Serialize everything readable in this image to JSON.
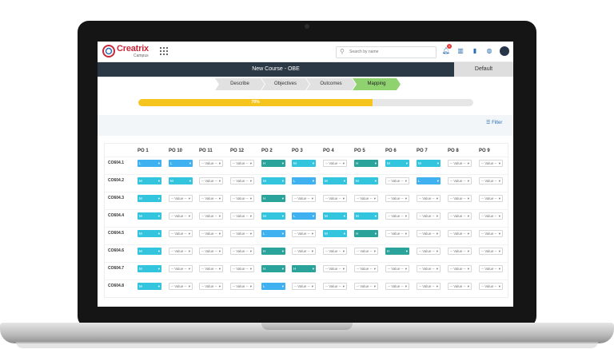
{
  "app": {
    "brand": "Creatrix",
    "brand_sub": "Campus",
    "search_placeholder": "Search by name",
    "notification_count": "1",
    "page_title": "New Course - OBE",
    "default_tab": "Default",
    "filter_label": "Filter"
  },
  "steps": [
    {
      "label": "Describe",
      "active": false
    },
    {
      "label": "Objectives",
      "active": false
    },
    {
      "label": "Outcomes",
      "active": false
    },
    {
      "label": "Mapping",
      "active": true
    }
  ],
  "progress": {
    "percent": 70,
    "label": "70%"
  },
  "colors": {
    "L": "#3fb0f0",
    "M": "#33c4de",
    "H": "#2aa39b",
    "progress": "#f5c51e",
    "accent": "#c8283a"
  },
  "icons": [
    "logo-icon",
    "apps-grid-icon",
    "search-icon",
    "bell-icon",
    "building-icon",
    "book-icon",
    "globe-icon",
    "avatar-icon",
    "filter-icon"
  ],
  "mapping": {
    "columns": [
      "PO 1",
      "PO 10",
      "PO 11",
      "PO 12",
      "PO 2",
      "PO 3",
      "PO 4",
      "PO 5",
      "PO 6",
      "PO 7",
      "PO 8",
      "PO 9"
    ],
    "empty_value": "-- Value --",
    "rows": [
      {
        "label": "CO604.1",
        "values": [
          "L",
          "L",
          "",
          "",
          "H",
          "M",
          "",
          "H",
          "M",
          "M",
          "",
          ""
        ]
      },
      {
        "label": "CO604.2",
        "values": [
          "M",
          "M",
          "",
          "",
          "M",
          "L",
          "M",
          "M",
          "",
          "L",
          "",
          ""
        ]
      },
      {
        "label": "CO604.3",
        "values": [
          "M",
          "",
          "",
          "",
          "H",
          "",
          "",
          "",
          "",
          "",
          "",
          ""
        ]
      },
      {
        "label": "CO604.4",
        "values": [
          "M",
          "",
          "",
          "",
          "M",
          "L",
          "M",
          "M",
          "",
          "",
          "",
          ""
        ]
      },
      {
        "label": "CO604.5",
        "values": [
          "M",
          "",
          "",
          "",
          "L",
          "",
          "M",
          "H",
          "",
          "",
          "",
          ""
        ]
      },
      {
        "label": "CO604.6",
        "values": [
          "M",
          "",
          "",
          "",
          "H",
          "",
          "",
          "",
          "H",
          "",
          "",
          ""
        ]
      },
      {
        "label": "CO604.7",
        "values": [
          "M",
          "",
          "",
          "",
          "H",
          "H",
          "",
          "",
          "",
          "",
          "",
          ""
        ]
      },
      {
        "label": "CO604.8",
        "values": [
          "M",
          "",
          "",
          "",
          "L",
          "",
          "",
          "",
          "",
          "",
          "",
          ""
        ]
      }
    ]
  }
}
